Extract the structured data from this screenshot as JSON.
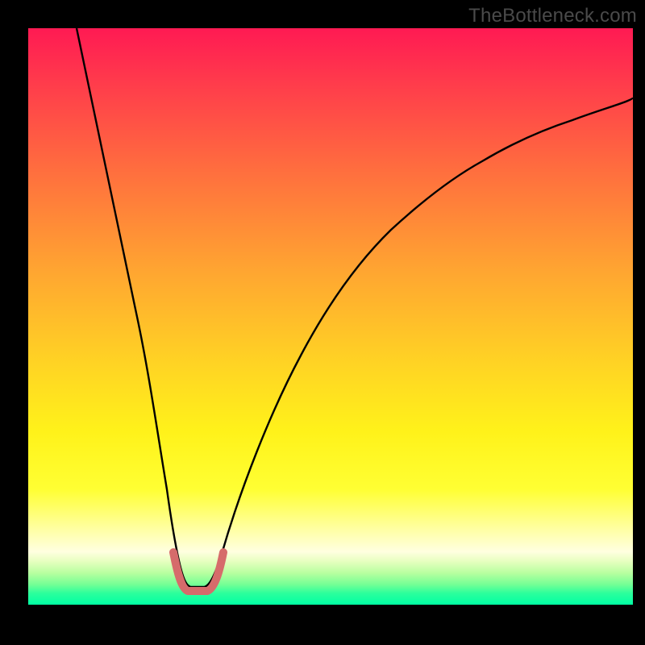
{
  "watermark": "TheBottleneck.com",
  "chart_data": {
    "type": "line",
    "title": "",
    "xlabel": "",
    "ylabel": "",
    "xlim": [
      0,
      100
    ],
    "ylim": [
      0,
      100
    ],
    "series": [
      {
        "name": "bottleneck-curve",
        "color": "#000000",
        "x": [
          8,
          12,
          15,
          18,
          20,
          22,
          24,
          26,
          27,
          28,
          29,
          30,
          35,
          40,
          45,
          50,
          55,
          60,
          65,
          70,
          75,
          80,
          85,
          90,
          95,
          100
        ],
        "y": [
          100,
          80,
          65,
          50,
          40,
          30,
          20,
          10,
          5,
          3,
          3,
          5,
          20,
          33,
          43,
          52,
          59,
          65,
          70,
          74,
          78,
          81,
          83,
          85,
          87,
          88
        ]
      },
      {
        "name": "optimal-zone",
        "color": "#d66b6b",
        "x": [
          24,
          25,
          26,
          27,
          28,
          29,
          30,
          31
        ],
        "y": [
          9,
          5,
          3,
          2,
          2,
          3,
          5,
          9
        ]
      }
    ],
    "gradient_stops": [
      {
        "pos": 0,
        "color": "#ff1a53"
      },
      {
        "pos": 25,
        "color": "#ff6f3e"
      },
      {
        "pos": 58,
        "color": "#ffd324"
      },
      {
        "pos": 80,
        "color": "#ffff33"
      },
      {
        "pos": 100,
        "color": "#00ffa3"
      }
    ]
  }
}
